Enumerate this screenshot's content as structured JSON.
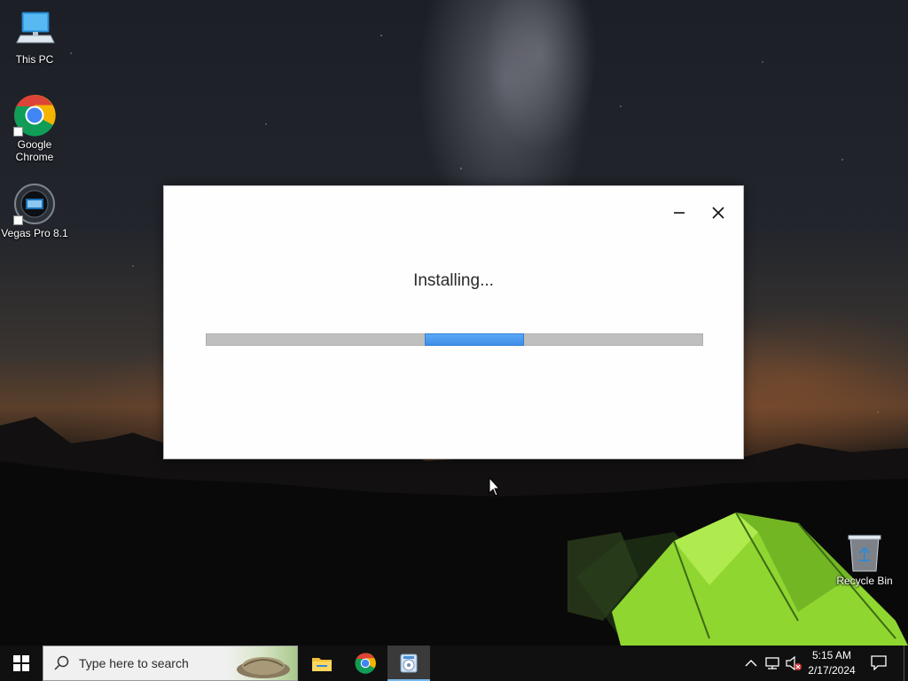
{
  "desktop": {
    "icons": [
      {
        "label": "This PC"
      },
      {
        "label": "Google\nChrome"
      },
      {
        "label": "Vegas Pro 8.1"
      },
      {
        "label": "Recycle Bin"
      }
    ]
  },
  "installer": {
    "status_text": "Installing...",
    "progress": {
      "mode": "indeterminate",
      "marquee_start_fraction": 0.44,
      "marquee_width_fraction": 0.2
    },
    "minimize_icon": "minimize-icon",
    "close_icon": "close-icon"
  },
  "taskbar": {
    "search_placeholder": "Type here to search",
    "pinned": [
      "file-explorer-icon",
      "chrome-icon",
      "installer-icon"
    ],
    "active": "installer-icon",
    "clock": {
      "time": "5:15 AM",
      "date": "2/17/2024"
    },
    "tray_icons": [
      "chevron-up-icon",
      "network-icon",
      "volume-muted-icon",
      "notification-icon"
    ]
  },
  "colors": {
    "taskbar_bg": "#101010",
    "progress_track": "#bfbfbf",
    "progress_fill": "#3d8ee8",
    "active_indicator": "#76b9ed",
    "tent_green": "#9be03a"
  }
}
